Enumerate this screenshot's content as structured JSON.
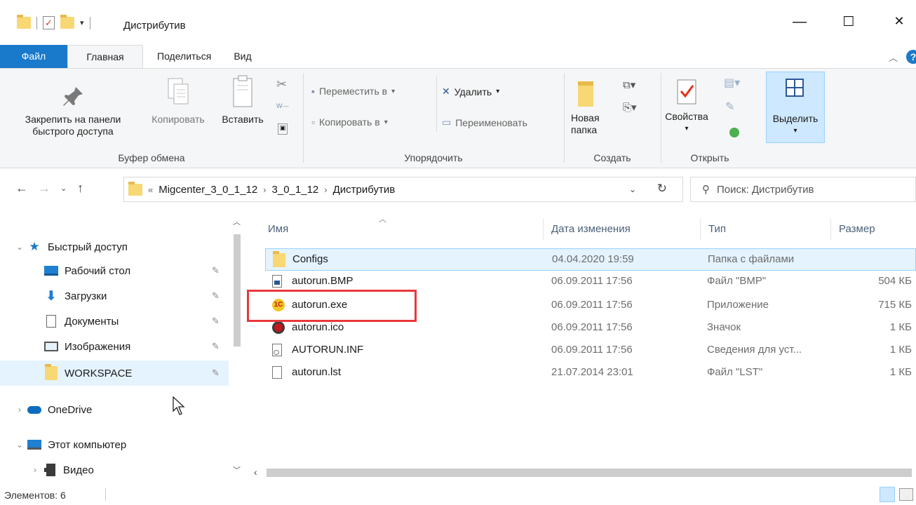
{
  "window": {
    "title": "Дистрибутив",
    "minimize": "—",
    "maximize": "☐",
    "close": "✕"
  },
  "ribbon_tabs": [
    "Файл",
    "Главная",
    "Поделиться",
    "Вид"
  ],
  "ribbon": {
    "clipboard": {
      "pin_line1": "Закрепить на панели",
      "pin_line2": "быстрого доступа",
      "copy": "Копировать",
      "paste": "Вставить",
      "label": "Буфер обмена"
    },
    "organize": {
      "move_to": "Переместить в",
      "copy_to": "Копировать в",
      "delete": "Удалить",
      "rename": "Переименовать",
      "label": "Упорядочить"
    },
    "new": {
      "new_folder_line1": "Новая",
      "new_folder_line2": "папка",
      "label": "Создать"
    },
    "open": {
      "properties": "Свойства",
      "label": "Открыть"
    },
    "select": {
      "select_all": "Выделить"
    }
  },
  "address": {
    "overflow": "«",
    "crumbs": [
      "Migcenter_3_0_1_12",
      "3_0_1_12",
      "Дистрибутив"
    ],
    "search_placeholder": "Поиск: Дистрибутив"
  },
  "navpane": {
    "quick_access": "Быстрый доступ",
    "items": [
      {
        "label": "Рабочий стол",
        "icon": "desktop-icon"
      },
      {
        "label": "Загрузки",
        "icon": "downloads-icon"
      },
      {
        "label": "Документы",
        "icon": "documents-icon"
      },
      {
        "label": "Изображения",
        "icon": "pictures-icon"
      },
      {
        "label": "WORKSPACE",
        "icon": "folder-icon"
      }
    ],
    "onedrive": "OneDrive",
    "this_pc": "Этот компьютер",
    "video": "Видео"
  },
  "columns": {
    "name": "Имя",
    "date": "Дата изменения",
    "type": "Тип",
    "size": "Размер"
  },
  "files": [
    {
      "name": "Configs",
      "date": "04.04.2020 19:59",
      "type": "Папка с файлами",
      "size": "",
      "icon": "folder-icon"
    },
    {
      "name": "autorun.BMP",
      "date": "06.09.2011 17:56",
      "type": "Файл \"BMP\"",
      "size": "504 КБ",
      "icon": "bmp-file-icon"
    },
    {
      "name": "autorun.exe",
      "date": "06.09.2011 17:56",
      "type": "Приложение",
      "size": "715 КБ",
      "icon": "1c-app-icon"
    },
    {
      "name": "autorun.ico",
      "date": "06.09.2011 17:56",
      "type": "Значок",
      "size": "1 КБ",
      "icon": "ico-file-icon"
    },
    {
      "name": "AUTORUN.INF",
      "date": "06.09.2011 17:56",
      "type": "Сведения для уст...",
      "size": "1 КБ",
      "icon": "inf-file-icon"
    },
    {
      "name": "autorun.lst",
      "date": "21.07.2014 23:01",
      "type": "Файл \"LST\"",
      "size": "1 КБ",
      "icon": "generic-file-icon"
    }
  ],
  "status": {
    "count": "Элементов: 6"
  },
  "colors": {
    "file_tab": "#1979ca",
    "selection": "#cde8ff",
    "highlight_box": "#e8383d"
  }
}
